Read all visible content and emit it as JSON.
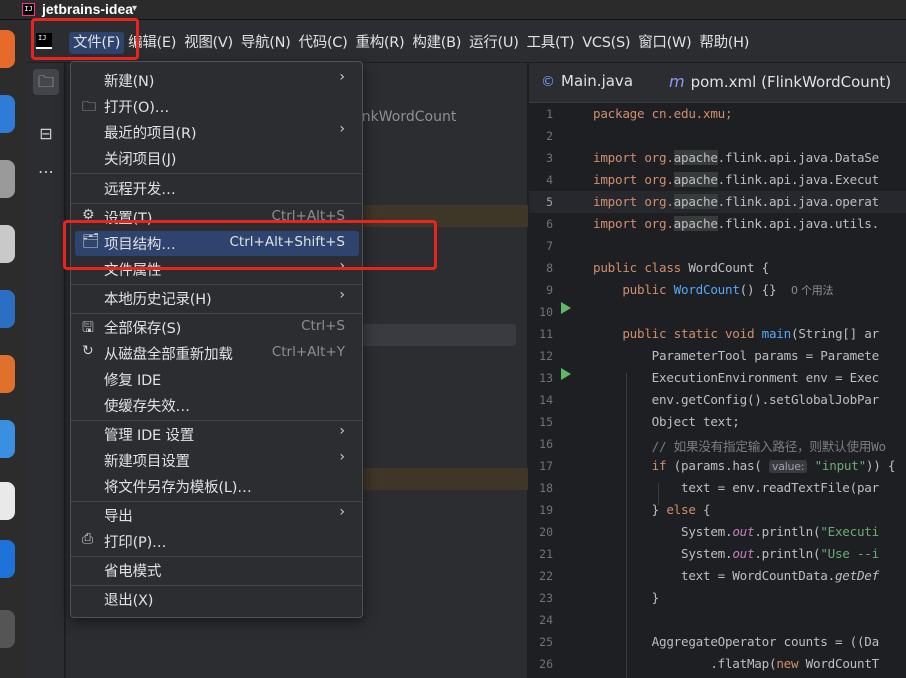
{
  "topbar": {
    "app_name": "jetbrains-idea",
    "caret": "▾"
  },
  "menubar": {
    "items": [
      "文件(F)",
      "编辑(E)",
      "视图(V)",
      "导航(N)",
      "代码(C)",
      "重构(R)",
      "构建(B)",
      "运行(U)",
      "工具(T)",
      "VCS(S)",
      "窗口(W)",
      "帮助(H)"
    ]
  },
  "project_panel": {
    "ghost_text": "linkWordCount"
  },
  "tabs": [
    {
      "icon": "©",
      "label": "Main.java"
    },
    {
      "icon": "m",
      "label": "pom.xml (FlinkWordCount)"
    }
  ],
  "file_menu": {
    "items": [
      {
        "label": "新建(N)",
        "shortcut": "",
        "submenu": true,
        "icon": ""
      },
      {
        "label": "打开(O)…",
        "shortcut": "",
        "submenu": false,
        "icon": "folder-icon"
      },
      {
        "label": "最近的项目(R)",
        "shortcut": "",
        "submenu": true,
        "icon": ""
      },
      {
        "label": "关闭项目(J)",
        "shortcut": "",
        "submenu": false,
        "icon": ""
      },
      {
        "label": "远程开发…",
        "shortcut": "",
        "submenu": false,
        "icon": ""
      },
      {
        "label": "设置(T)…",
        "shortcut": "Ctrl+Alt+S",
        "submenu": false,
        "icon": "gear-icon"
      },
      {
        "label": "项目结构…",
        "shortcut": "Ctrl+Alt+Shift+S",
        "submenu": false,
        "icon": "project-structure-icon",
        "highlighted": true
      },
      {
        "label": "文件属性",
        "shortcut": "",
        "submenu": true,
        "icon": ""
      },
      {
        "label": "本地历史记录(H)",
        "shortcut": "",
        "submenu": true,
        "icon": ""
      },
      {
        "label": "全部保存(S)",
        "shortcut": "Ctrl+S",
        "submenu": false,
        "icon": "save-icon"
      },
      {
        "label": "从磁盘全部重新加载",
        "shortcut": "Ctrl+Alt+Y",
        "submenu": false,
        "icon": "reload-icon"
      },
      {
        "label": "修复 IDE",
        "shortcut": "",
        "submenu": false,
        "icon": ""
      },
      {
        "label": "使缓存失效…",
        "shortcut": "",
        "submenu": false,
        "icon": ""
      },
      {
        "label": "管理 IDE 设置",
        "shortcut": "",
        "submenu": true,
        "icon": ""
      },
      {
        "label": "新建项目设置",
        "shortcut": "",
        "submenu": true,
        "icon": ""
      },
      {
        "label": "将文件另存为模板(L)…",
        "shortcut": "",
        "submenu": false,
        "icon": ""
      },
      {
        "label": "导出",
        "shortcut": "",
        "submenu": true,
        "icon": ""
      },
      {
        "label": "打印(P)…",
        "shortcut": "",
        "submenu": false,
        "icon": "print-icon"
      },
      {
        "label": "省电模式",
        "shortcut": "",
        "submenu": false,
        "icon": ""
      },
      {
        "label": "退出(X)",
        "shortcut": "",
        "submenu": false,
        "icon": ""
      }
    ]
  },
  "editor": {
    "current_line": 5,
    "line_numbers": [
      "1",
      "2",
      "3",
      "4",
      "5",
      "6",
      "7",
      "8",
      "9",
      "10",
      "11",
      "12",
      "13",
      "14",
      "15",
      "16",
      "17",
      "18",
      "19",
      "20",
      "21",
      "22",
      "23",
      "24",
      "25",
      "26"
    ],
    "code": {
      "l1": "package cn.edu.xmu;",
      "l3a": "import org.",
      "l3b": "apache",
      "l3c": ".flink.api.java.DataSe",
      "l4a": "import org.",
      "l4b": "apache",
      "l4c": ".flink.api.java.Execut",
      "l5a": "import org.",
      "l5b": "apache",
      "l5c": ".flink.api.java.operat",
      "l6a": "import org.",
      "l6b": "apache",
      "l6c": ".flink.api.java.utils.",
      "l8a": "public class ",
      "l8b": "WordCount {",
      "l9a": "    public ",
      "l9b": "WordCount",
      "l9c": "() {}  ",
      "l9d": "0 个用法",
      "l11a": "    public static void ",
      "l11b": "main",
      "l11c": "(String[] ar",
      "l12": "        ParameterTool params = Paramete",
      "l13": "        ExecutionEnvironment env = Exec",
      "l14": "        env.getConfig().setGlobalJobPar",
      "l15": "        Object text;",
      "l16": "        // 如果没有指定输入路径，则默认使用Wo",
      "l17a": "        if ",
      "l17b": "(params.has( ",
      "l17c": "value:",
      "l17d": " \"input\"",
      "l17e": ")) {",
      "l18": "            text = env.readTextFile(par",
      "l19a": "        } ",
      "l19b": "else",
      "l19c": " {",
      "l20a": "            System.",
      "l20b": "out",
      "l20c": ".println(",
      "l20d": "\"Executi",
      "l21a": "            System.",
      "l21b": "out",
      "l21c": ".println(",
      "l21d": "\"Use --i",
      "l22a": "            text = WordCountData.",
      "l22b": "getDef",
      "l23": "        }",
      "l25": "        AggregateOperator counts = ((Da",
      "l26a": "                .flatMap(",
      "l26b": "new ",
      "l26c": "WordCountT"
    }
  },
  "colors": {
    "highlight": "#2e436e",
    "annotation": "#e8241c",
    "run": "#5fb865"
  }
}
